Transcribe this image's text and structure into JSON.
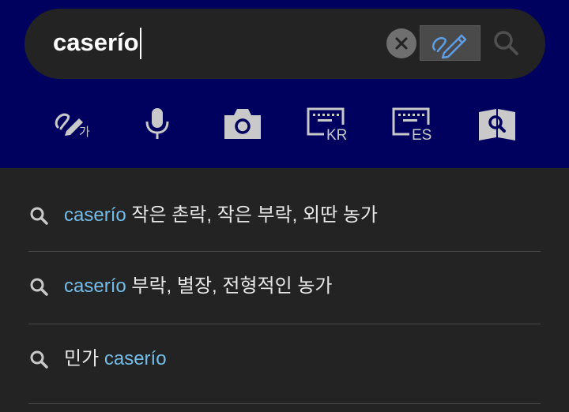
{
  "search": {
    "query": "caserío"
  },
  "toolbar": {
    "handwriting_ko_label": "가",
    "keyboard_kr_label": "KR",
    "keyboard_es_label": "ES"
  },
  "suggestions": [
    {
      "term": "caserío",
      "meaning": "작은 촌락, 작은 부락, 외딴 농가"
    },
    {
      "term": "caserío",
      "meaning": "부락, 별장, 전형적인 농가"
    },
    {
      "meaning": "민가",
      "term": "caserío"
    }
  ],
  "colors": {
    "header_bg": "#00005e",
    "panel_bg": "#232323",
    "highlight": "#73bde8",
    "icon": "#c9c9c9"
  }
}
